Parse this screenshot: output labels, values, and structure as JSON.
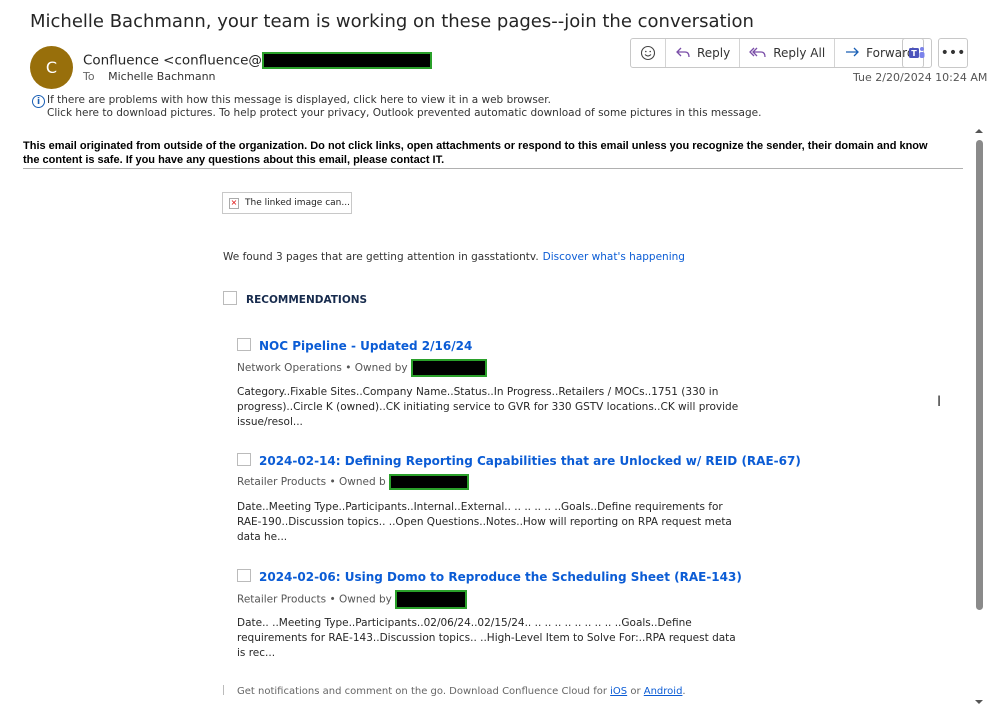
{
  "subject": "Michelle Bachmann, your team is working on these pages--join the conversation",
  "sender": {
    "initial": "C",
    "name": "Confluence <confluence@",
    "to_label": "To",
    "to": "Michelle Bachmann"
  },
  "actions": {
    "reply": "Reply",
    "reply_all": "Reply All",
    "forward": "Forward"
  },
  "date": "Tue 2/20/2024 10:24 AM",
  "info": {
    "line1": "If there are problems with how this message is displayed, click here to view it in a web browser.",
    "line2": "Click here to download pictures. To help protect your privacy, Outlook prevented automatic download of some pictures in this message."
  },
  "warning": "This email originated from outside of the organization. Do not click links, open attachments or respond to this email unless you recognize the sender, their domain and know the content is safe. If you have any questions about this email, please contact IT.",
  "body": {
    "broken_image": "The linked image can...",
    "intro": "We found 3 pages that are getting attention in gasstationtv.",
    "intro_link": "Discover what's happening",
    "recommendations": "RECOMMENDATIONS",
    "pages": [
      {
        "title": "NOC Pipeline - Updated 2/16/24",
        "meta": "Network Operations • Owned by",
        "desc": "Category..Fixable Sites..Company Name..Status..In Progress..Retailers / MOCs..1751 (330 in progress)..Circle K (owned)..CK initiating service to GVR for 330 GSTV locations..CK will provide issue/resol..."
      },
      {
        "title": "2024-02-14: Defining Reporting Capabilities that are Unlocked w/ REID (RAE-67)",
        "meta": "Retailer Products • Owned b",
        "desc": "Date..Meeting Type..Participants..Internal..External.. .. .. .. .. ..Goals..Define requirements for RAE-190..Discussion topics.. ..Open Questions..Notes..How will reporting on RPA request meta data he..."
      },
      {
        "title": "2024-02-06: Using Domo to Reproduce the Scheduling Sheet (RAE-143)",
        "meta": "Retailer Products • Owned by",
        "desc": "Date.. ..Meeting Type..Participants..02/06/24..02/15/24.. .. .. .. .. .. .. .. .. ..Goals..Define requirements for RAE-143..Discussion topics.. ..High-Level Item to Solve For:..RPA request data is rec..."
      }
    ],
    "footer_text": "Get notifications and comment on the go. Download Confluence Cloud for",
    "footer_ios": "iOS",
    "footer_or": "or",
    "footer_android": "Android",
    "footer_end": "."
  }
}
